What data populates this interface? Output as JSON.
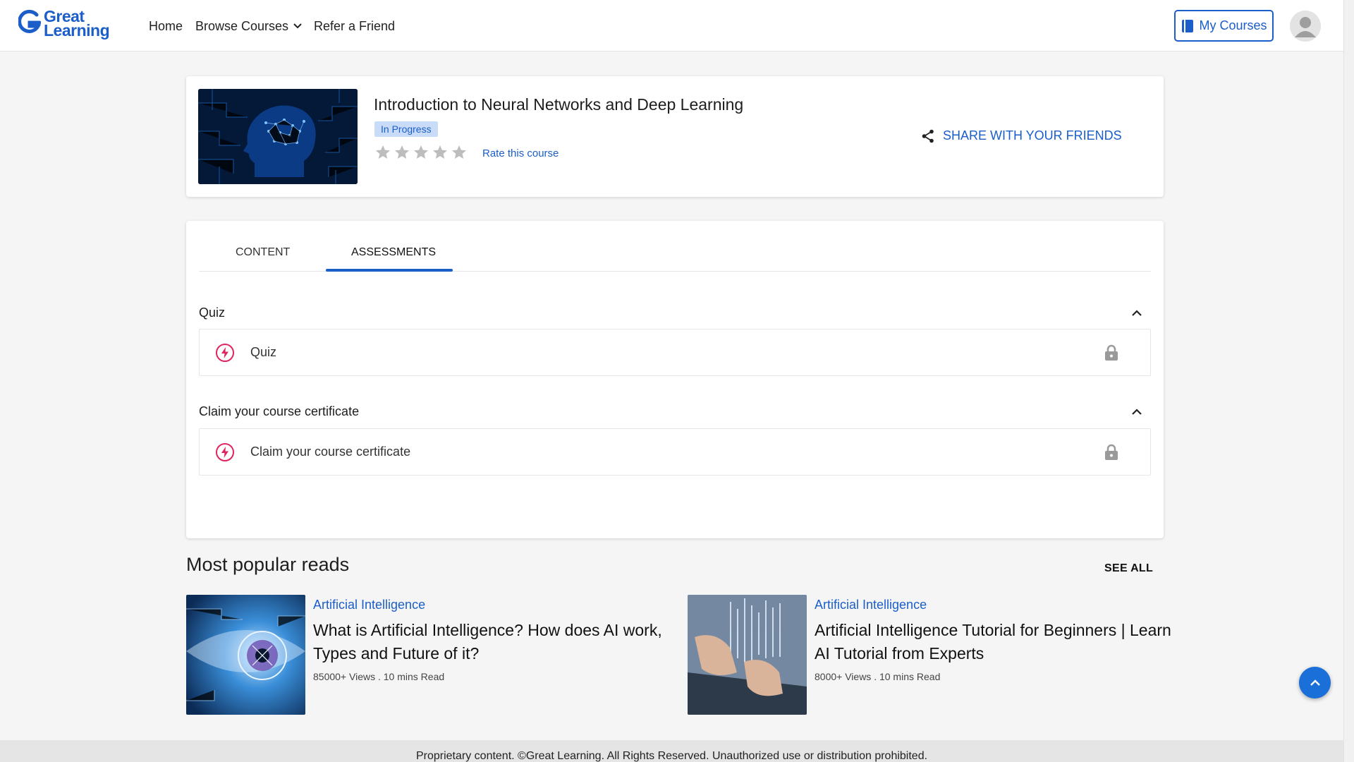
{
  "brand": {
    "line1": "Great",
    "line2": "Learning",
    "accent": "#1b5ec9"
  },
  "nav": {
    "home": "Home",
    "browse": "Browse Courses",
    "refer": "Refer a Friend"
  },
  "header": {
    "my_courses": "My Courses"
  },
  "course": {
    "title": "Introduction to Neural Networks and Deep Learning",
    "status": "In Progress",
    "rating_stars": 0,
    "rate_label": "Rate this course",
    "share_label": "SHARE WITH YOUR FRIENDS"
  },
  "tabs": {
    "content": "CONTENT",
    "assessments": "ASSESSMENTS",
    "active": "ASSESSMENTS"
  },
  "sections": [
    {
      "title": "Quiz",
      "items": [
        {
          "label": "Quiz",
          "locked": true
        }
      ]
    },
    {
      "title": "Claim your course certificate",
      "items": [
        {
          "label": "Claim your course certificate",
          "locked": true
        }
      ]
    }
  ],
  "popular": {
    "title": "Most popular reads",
    "see_all": "SEE ALL",
    "articles": [
      {
        "category": "Artificial Intelligence",
        "title": "What is Artificial Intelligence? How does AI work, Types and Future of it?",
        "meta": "85000+ Views . 10 mins Read"
      },
      {
        "category": "Artificial Intelligence",
        "title": "Artificial Intelligence Tutorial for Beginners | Learn AI Tutorial from Experts",
        "meta": "8000+ Views . 10 mins Read"
      }
    ]
  },
  "footer": {
    "text": "Proprietary content. ©Great Learning. All Rights Reserved. Unauthorized use or distribution prohibited."
  }
}
